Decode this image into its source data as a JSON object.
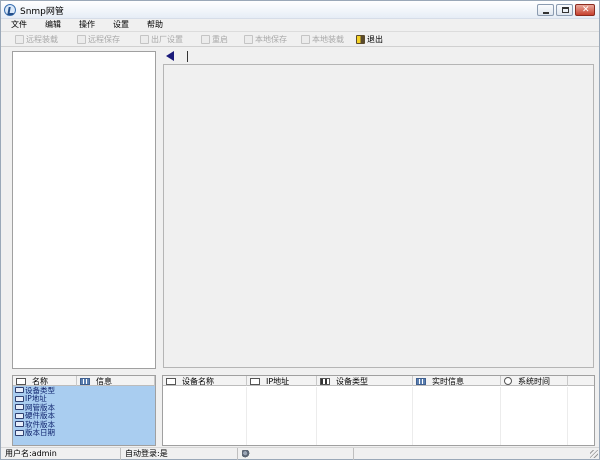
{
  "window": {
    "title": "Snmp网管"
  },
  "menu": [
    "文件",
    "编辑",
    "操作",
    "设置",
    "帮助"
  ],
  "toolbar": [
    {
      "label": "远程装载",
      "icon": "remote-load-icon",
      "enabled": false
    },
    {
      "label": "远程保存",
      "icon": "remote-save-icon",
      "enabled": false
    },
    {
      "label": "出厂设置",
      "icon": "factory-reset-icon",
      "enabled": false
    },
    {
      "label": "重启",
      "icon": "restart-icon",
      "enabled": false
    },
    {
      "label": "本地保存",
      "icon": "local-save-icon",
      "enabled": false
    },
    {
      "label": "本地装载",
      "icon": "local-load-icon",
      "enabled": false
    },
    {
      "label": "退出",
      "icon": "exit-door-icon",
      "enabled": true
    }
  ],
  "info_table": {
    "columns": [
      "名称",
      "信息"
    ],
    "rows": [
      "设备类型",
      "IP地址",
      "网管版本",
      "硬件版本",
      "软件版本",
      "版本日期"
    ]
  },
  "device_table": {
    "columns": [
      "设备名称",
      "IP地址",
      "设备类型",
      "实时信息",
      "系统时间"
    ]
  },
  "status": {
    "user": "用户名:admin",
    "autologin": "自动登录:是"
  },
  "colors": {
    "selection": "#a9cdf0",
    "row_text": "#10246e"
  }
}
